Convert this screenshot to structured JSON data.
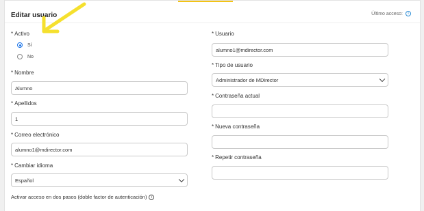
{
  "header": {
    "title": "Editar usuario",
    "last_access_label": "Último acceso:"
  },
  "colors": {
    "accent": "#f3c316",
    "primary": "#1a73e8",
    "annotation_arrow": "#f5e02e"
  },
  "form": {
    "activo": {
      "label": "Activo",
      "options": [
        "Sí",
        "No"
      ],
      "selected": "Sí"
    },
    "nombre": {
      "label": "Nombre",
      "value": "Alumno"
    },
    "apellidos": {
      "label": "Apellidos",
      "value": "1"
    },
    "correo": {
      "label": "Correo electrónico",
      "value": "alumno1@mdirector.com"
    },
    "idioma": {
      "label": "Cambiar idioma",
      "value": "Español"
    },
    "usuario": {
      "label": "Usuario",
      "value": "alumno1@mdirector.com"
    },
    "tipo_usuario": {
      "label": "Tipo de usuario",
      "value": "Administrador de MDirector"
    },
    "contrasena_actual": {
      "label": "Contraseña actual",
      "value": ""
    },
    "nueva_contrasena": {
      "label": "Nueva contraseña",
      "value": ""
    },
    "repetir_contrasena": {
      "label": "Repetir contraseña",
      "value": ""
    },
    "two_factor": {
      "label": "Activar acceso en dos pasos (doble factor de autenticación)"
    }
  }
}
